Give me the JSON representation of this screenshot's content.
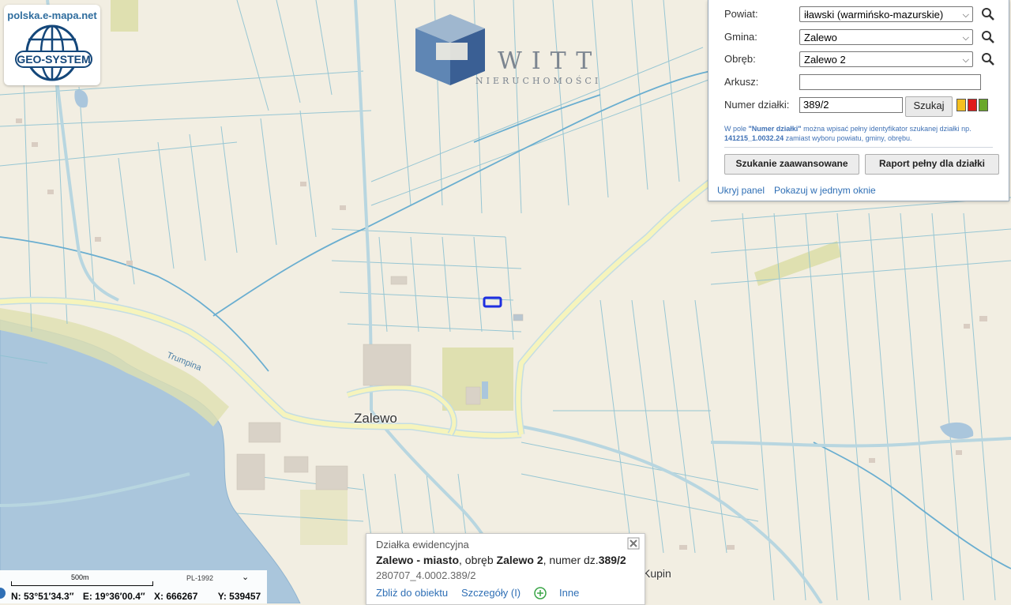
{
  "map": {
    "town_label": "Zalewo",
    "river_label": "Trumpina",
    "village_label": "Kupin"
  },
  "logo": {
    "url_text": "polska.e-mapa.net",
    "brand": "GEO-SYSTEM"
  },
  "watermark": {
    "word": "WITT",
    "subtitle": "NIERUCHOMOŚCI"
  },
  "search_panel": {
    "powiat_label": "Powiat:",
    "powiat_value": "iławski (warmińsko-mazurskie)",
    "gmina_label": "Gmina:",
    "gmina_value": "Zalewo",
    "obreb_label": "Obręb:",
    "obreb_value": "Zalewo 2",
    "arkusz_label": "Arkusz:",
    "arkusz_value": "",
    "numer_label": "Numer działki:",
    "numer_value": "389/2",
    "search_button": "Szukaj",
    "hint_pre": "W pole ",
    "hint_bold1": "\"Numer działki\"",
    "hint_mid": " można wpisać pełny identyfikator szukanej działki np. ",
    "hint_bold2": "141215_1.0032.24",
    "hint_post": " zamiast wyboru powiatu, gminy, obrębu.",
    "advanced_button": "Szukanie zaawansowane",
    "report_button": "Raport pełny dla działki",
    "hide_link": "Ukryj panel",
    "one_window_link": "Pokazuj w jednym oknie",
    "swatch_colors": [
      "#f5c020",
      "#e01a1a",
      "#6aa82a"
    ]
  },
  "parcel_popup": {
    "heading": "Działka ewidencyjna",
    "place": "Zalewo - miasto",
    "sep1": ", obręb ",
    "obreb": "Zalewo 2",
    "sep2": ", numer dz.",
    "number": "389/2",
    "identifier": "280707_4.0002.389/2",
    "zoom_link": "Zbliż do obiektu",
    "details_link": "Szczegóły (I)",
    "other_link": "Inne"
  },
  "status_bar": {
    "scale_label": "500m",
    "projection": "PL-1992",
    "lat": "N: 53°51′34.3″",
    "lon": "E: 19°36′00.4″",
    "x": "X: 666267",
    "y": "Y: 539457"
  },
  "colors": {
    "land": "#f2eee2",
    "water": "#aac6dc",
    "parcel_lines": "#8ec2d2",
    "roads_main": "#f6f4bc",
    "highlight": "#1f2fe0",
    "forest": "#dfe0b0"
  }
}
